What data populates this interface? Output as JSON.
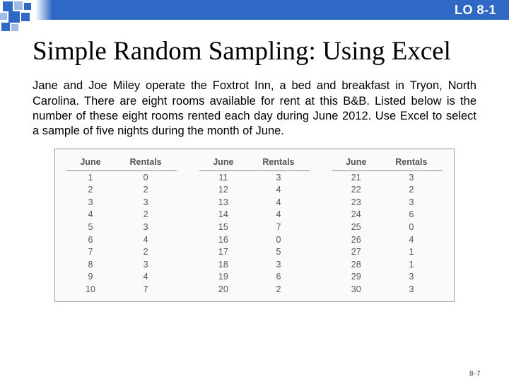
{
  "header": {
    "lo_label": "LO 8-1"
  },
  "title": "Simple Random Sampling: Using Excel",
  "paragraph": "Jane and Joe Miley operate the Foxtrot Inn, a bed and breakfast in Tryon, North Carolina. There are eight rooms available for rent at this B&B. Listed below is the number of these eight rooms rented each day during June 2012. Use Excel to select a sample of five nights during the month of June.",
  "table": {
    "headers": [
      "June",
      "Rentals",
      "June",
      "Rentals",
      "June",
      "Rentals"
    ],
    "rows": [
      [
        "1",
        "0",
        "11",
        "3",
        "21",
        "3"
      ],
      [
        "2",
        "2",
        "12",
        "4",
        "22",
        "2"
      ],
      [
        "3",
        "3",
        "13",
        "4",
        "23",
        "3"
      ],
      [
        "4",
        "2",
        "14",
        "4",
        "24",
        "6"
      ],
      [
        "5",
        "3",
        "15",
        "7",
        "25",
        "0"
      ],
      [
        "6",
        "4",
        "16",
        "0",
        "26",
        "4"
      ],
      [
        "7",
        "2",
        "17",
        "5",
        "27",
        "1"
      ],
      [
        "8",
        "3",
        "18",
        "3",
        "28",
        "1"
      ],
      [
        "9",
        "4",
        "19",
        "6",
        "29",
        "3"
      ],
      [
        "10",
        "7",
        "20",
        "2",
        "30",
        "3"
      ]
    ]
  },
  "page_number": "8-7",
  "chart_data": {
    "type": "table",
    "title": "Rooms rented each day during June 2012",
    "columns": [
      "June",
      "Rentals"
    ],
    "data": [
      {
        "June": 1,
        "Rentals": 0
      },
      {
        "June": 2,
        "Rentals": 2
      },
      {
        "June": 3,
        "Rentals": 3
      },
      {
        "June": 4,
        "Rentals": 2
      },
      {
        "June": 5,
        "Rentals": 3
      },
      {
        "June": 6,
        "Rentals": 4
      },
      {
        "June": 7,
        "Rentals": 2
      },
      {
        "June": 8,
        "Rentals": 3
      },
      {
        "June": 9,
        "Rentals": 4
      },
      {
        "June": 10,
        "Rentals": 7
      },
      {
        "June": 11,
        "Rentals": 3
      },
      {
        "June": 12,
        "Rentals": 4
      },
      {
        "June": 13,
        "Rentals": 4
      },
      {
        "June": 14,
        "Rentals": 4
      },
      {
        "June": 15,
        "Rentals": 7
      },
      {
        "June": 16,
        "Rentals": 0
      },
      {
        "June": 17,
        "Rentals": 5
      },
      {
        "June": 18,
        "Rentals": 3
      },
      {
        "June": 19,
        "Rentals": 6
      },
      {
        "June": 20,
        "Rentals": 2
      },
      {
        "June": 21,
        "Rentals": 3
      },
      {
        "June": 22,
        "Rentals": 2
      },
      {
        "June": 23,
        "Rentals": 3
      },
      {
        "June": 24,
        "Rentals": 6
      },
      {
        "June": 25,
        "Rentals": 0
      },
      {
        "June": 26,
        "Rentals": 4
      },
      {
        "June": 27,
        "Rentals": 1
      },
      {
        "June": 28,
        "Rentals": 1
      },
      {
        "June": 29,
        "Rentals": 3
      },
      {
        "June": 30,
        "Rentals": 3
      }
    ]
  }
}
